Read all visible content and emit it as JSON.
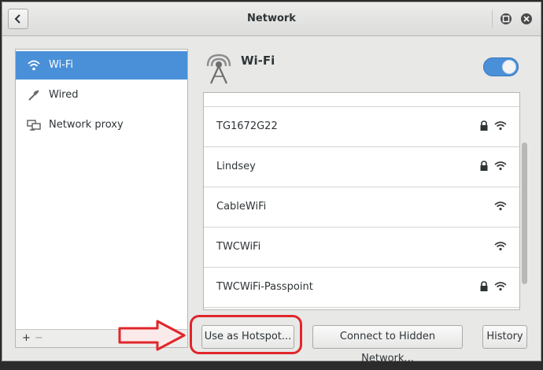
{
  "window": {
    "title": "Network"
  },
  "sidebar": {
    "items": [
      {
        "label": "Wi-Fi",
        "icon": "wifi-icon",
        "active": true
      },
      {
        "label": "Wired",
        "icon": "wired-icon",
        "active": false
      },
      {
        "label": "Network proxy",
        "icon": "network-proxy-icon",
        "active": false
      }
    ],
    "add_label": "+",
    "remove_label": "−"
  },
  "main": {
    "title": "Wi-Fi",
    "wifi_enabled": true,
    "networks": [
      {
        "name": "TG1672G22",
        "secured": true,
        "icon": "wifi-signal-icon"
      },
      {
        "name": "Lindsey",
        "secured": true,
        "icon": "wifi-signal-icon"
      },
      {
        "name": "CableWiFi",
        "secured": false,
        "icon": "wifi-signal-icon"
      },
      {
        "name": "TWCWiFi",
        "secured": false,
        "icon": "wifi-signal-icon"
      },
      {
        "name": "TWCWiFi-Passpoint",
        "secured": true,
        "icon": "wifi-signal-icon"
      }
    ]
  },
  "buttons": {
    "hotspot": "Use as Hotspot...",
    "hidden": "Connect to Hidden Network...",
    "history": "History"
  },
  "colors": {
    "accent": "#4a90d9",
    "annotation": "#e0262b"
  }
}
